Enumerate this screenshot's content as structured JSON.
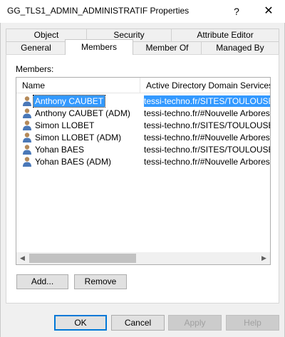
{
  "window": {
    "title": "GG_TLS1_ADMIN_ADMINISTRATIF Properties",
    "help_glyph": "?",
    "close_glyph": "✕"
  },
  "tabs": {
    "row1": [
      {
        "label": "Object"
      },
      {
        "label": "Security"
      },
      {
        "label": "Attribute Editor"
      }
    ],
    "row2": [
      {
        "label": "General"
      },
      {
        "label": "Members",
        "selected": true
      },
      {
        "label": "Member Of"
      },
      {
        "label": "Managed By"
      }
    ]
  },
  "members": {
    "label": "Members:",
    "columns": [
      "Name",
      "Active Directory Domain Services Fo"
    ],
    "rows": [
      {
        "name": "Anthony CAUBET",
        "path": "tessi-techno.fr/SITES/TOULOUSE/U",
        "selected": true
      },
      {
        "name": "Anthony CAUBET (ADM)",
        "path": "tessi-techno.fr/#Nouvelle Arborescen"
      },
      {
        "name": "Simon LLOBET",
        "path": "tessi-techno.fr/SITES/TOULOUSE/U"
      },
      {
        "name": "Simon LLOBET (ADM)",
        "path": "tessi-techno.fr/#Nouvelle Arborescen"
      },
      {
        "name": "Yohan BAES",
        "path": "tessi-techno.fr/SITES/TOULOUSE/U"
      },
      {
        "name": "Yohan BAES (ADM)",
        "path": "tessi-techno.fr/#Nouvelle Arborescen"
      }
    ],
    "row_icon": "user-icon"
  },
  "actions": {
    "add": "Add...",
    "remove": "Remove"
  },
  "footer": {
    "ok": "OK",
    "cancel": "Cancel",
    "apply": "Apply",
    "help": "Help"
  },
  "colors": {
    "selection": "#3399ff",
    "default_button_border": "#0078d7",
    "dialog_bg": "#f0f0f0"
  }
}
